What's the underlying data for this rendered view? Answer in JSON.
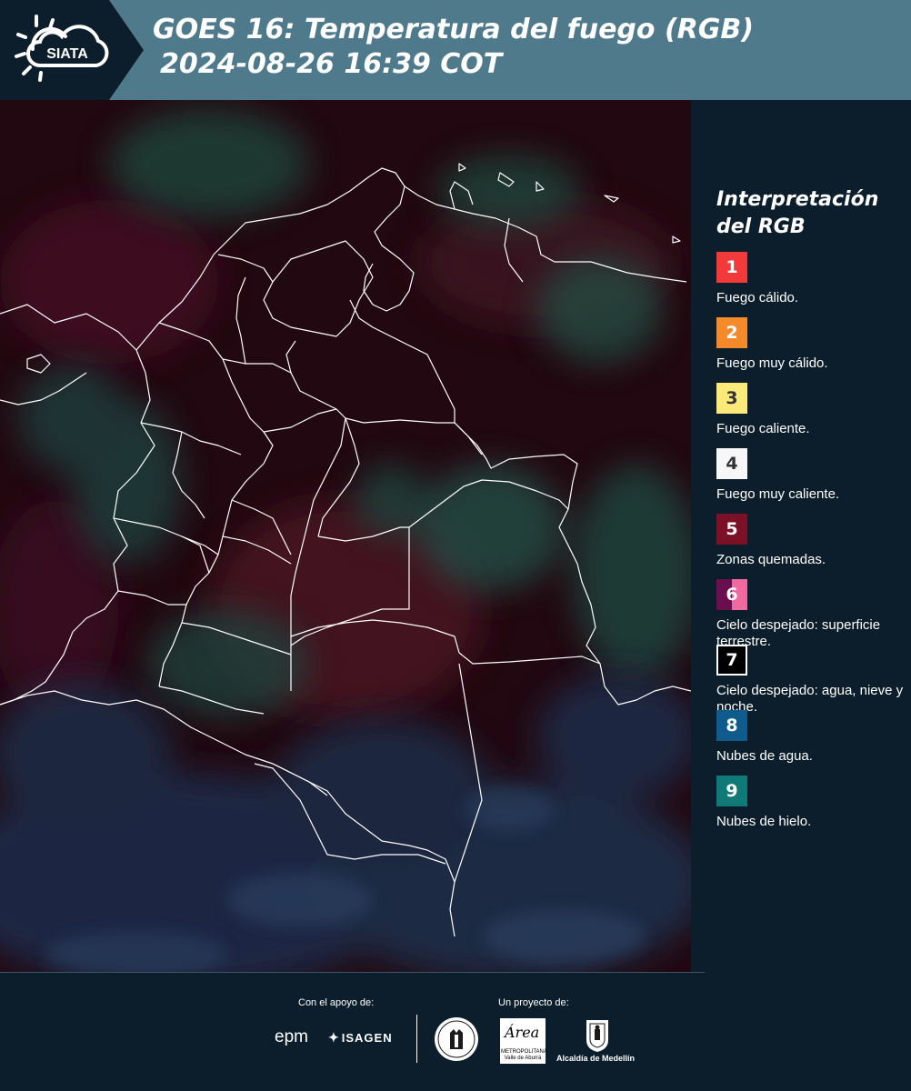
{
  "header": {
    "logo_text": "SIATA",
    "title_line1": "GOES 16: Temperatura del fuego (RGB)",
    "title_line2": "2024-08-26 16:39 COT"
  },
  "legend": {
    "title_line1": "Interpretación",
    "title_line2": "del RGB",
    "items": [
      {
        "number": "1",
        "label": "Fuego cálido.",
        "color": "#f23a3a",
        "text_color": "#ffffff"
      },
      {
        "number": "2",
        "label": "Fuego muy cálido.",
        "color": "#f58a2c",
        "text_color": "#ffffff"
      },
      {
        "number": "3",
        "label": "Fuego caliente.",
        "color": "#fbe97a",
        "text_color": "#333333"
      },
      {
        "number": "4",
        "label": "Fuego muy caliente.",
        "color": "#f7f7f7",
        "text_color": "#333333"
      },
      {
        "number": "5",
        "label": "Zonas quemadas.",
        "color": "#7a1126",
        "text_color": "#ffffff"
      },
      {
        "number": "6",
        "label": "Cielo despejado: superficie terrestre.",
        "color": "#6a0e4e",
        "color2": "#f06aa0",
        "text_color": "#ffffff"
      },
      {
        "number": "7",
        "label": "Cielo despejado: agua, nieve y noche.",
        "color": "#000000",
        "text_color": "#ffffff",
        "border": "#ffffff"
      },
      {
        "number": "8",
        "label": "Nubes de agua.",
        "color": "#0f5c8c",
        "text_color": "#ffffff"
      },
      {
        "number": "9",
        "label": "Nubes de hielo.",
        "color": "#0f7a78",
        "text_color": "#ffffff"
      }
    ]
  },
  "footer": {
    "support_label": "Con el apoyo de:",
    "project_label": "Un proyecto de:",
    "sponsor_epm": "epm",
    "sponsor_isagen": "ISAGEN",
    "area_logo_word": "Área",
    "area_logo_subtitle": "METROPOLITANA Valle de Aburrá",
    "alcaldia": "Alcaldía de Medellín"
  },
  "colors": {
    "page_bg": "#0c1e2b",
    "header_band": "#4e7a8c",
    "map_base": "#220810",
    "border_lines": "#ffffff"
  }
}
